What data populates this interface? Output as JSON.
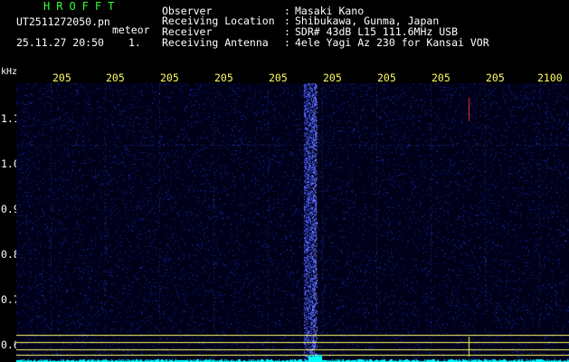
{
  "header": {
    "app_title": "HROFFT",
    "file_name": "UT2511272050.pn",
    "mode": "meteor",
    "datetime": "25.11.27 20:50",
    "frame": "1.",
    "fields": [
      {
        "label": "Observer",
        "value": "Masaki Kano"
      },
      {
        "label": "Receiving Location",
        "value": "Shibukawa, Gunma, Japan"
      },
      {
        "label": "Receiver",
        "value": "SDR# 43dB L15 111.6MHz USB"
      },
      {
        "label": "Receiving Antenna",
        "value": "4ele Yagi Az 230 for Kansai VOR"
      }
    ]
  },
  "spectrogram": {
    "y_unit": "kHz",
    "x_ticks": [
      "205",
      "205",
      "205",
      "205",
      "205",
      "205",
      "205",
      "205",
      "205",
      "2100"
    ],
    "y_ticks": [
      "1.1",
      "1.0",
      "0.9",
      "0.8",
      "0.7",
      "0.6"
    ],
    "colors": {
      "background": "#000018",
      "noise": "#1a2aa8",
      "grid": "#1e2a70",
      "signal": "#4f63ff",
      "echo": "#ff3030",
      "marker_line": "#ffff66",
      "base_line": "#00ffff"
    }
  }
}
